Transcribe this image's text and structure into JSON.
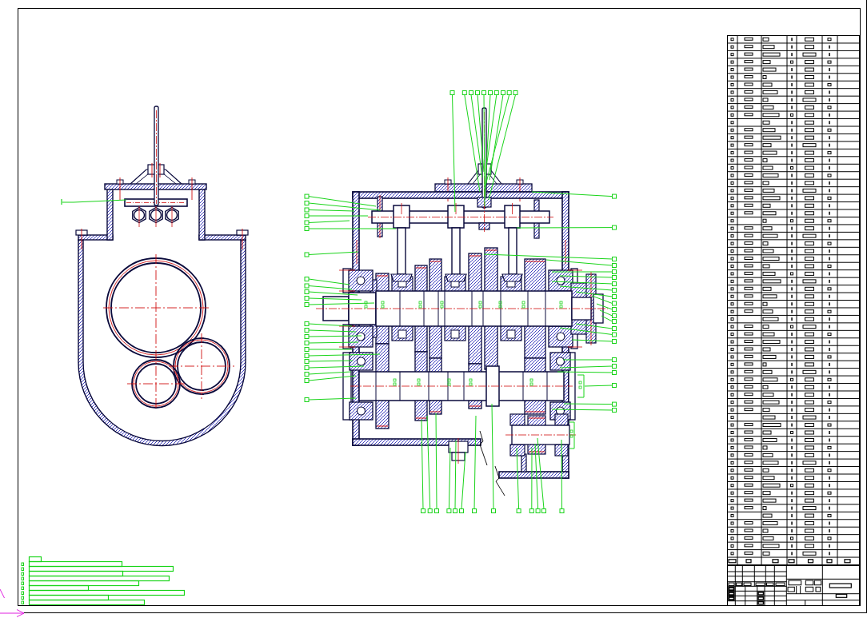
{
  "sheet": {
    "elements": [
      {
        "kind": "end_section_view"
      },
      {
        "kind": "longitudinal_section_view"
      },
      {
        "kind": "technical_notes"
      },
      {
        "kind": "direction_arrow"
      },
      {
        "kind": "parts_list"
      },
      {
        "kind": "title_block"
      }
    ]
  }
}
